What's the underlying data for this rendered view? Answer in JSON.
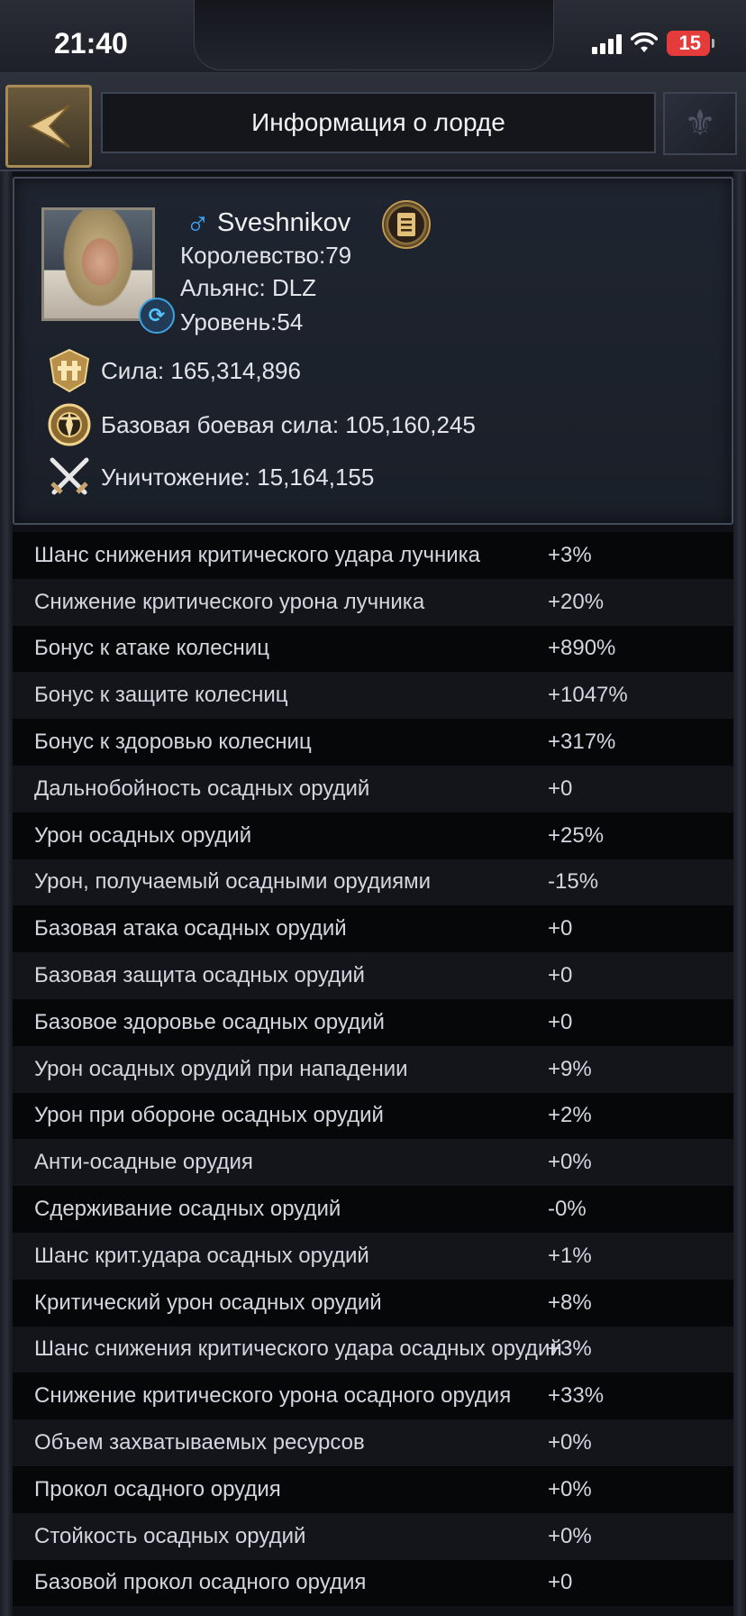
{
  "status_bar": {
    "time": "21:40",
    "battery": "15"
  },
  "header": {
    "title": "Информация о лорде"
  },
  "profile": {
    "name": "Sveshnikov",
    "kingdom": "Королевство:79",
    "alliance": "Альянс: DLZ",
    "level": "Уровень:54",
    "power": "Сила: 165,314,896",
    "base_power": "Базовая боевая сила: 105,160,245",
    "kills": "Уничтожение: 15,164,155"
  },
  "attributes": [
    {
      "label": "Шанс снижения критического удара лучника",
      "value": "+3%"
    },
    {
      "label": "Снижение критического урона лучника",
      "value": "+20%"
    },
    {
      "label": "Бонус к атаке колесниц",
      "value": "+890%"
    },
    {
      "label": "Бонус к защите колесниц",
      "value": "+1047%"
    },
    {
      "label": "Бонус к здоровью колесниц",
      "value": "+317%"
    },
    {
      "label": "Дальнобойность осадных орудий",
      "value": "+0"
    },
    {
      "label": "Урон осадных орудий",
      "value": "+25%"
    },
    {
      "label": "Урон, получаемый осадными орудиями",
      "value": "-15%"
    },
    {
      "label": "Базовая атака осадных орудий",
      "value": "+0"
    },
    {
      "label": "Базовая защита осадных орудий",
      "value": "+0"
    },
    {
      "label": "Базовое здоровье осадных орудий",
      "value": "+0"
    },
    {
      "label": "Урон осадных орудий при нападении",
      "value": "+9%"
    },
    {
      "label": "Урон при обороне осадных орудий",
      "value": "+2%"
    },
    {
      "label": "Анти-осадные орудия",
      "value": "+0%"
    },
    {
      "label": "Сдерживание осадных орудий",
      "value": "-0%"
    },
    {
      "label": "Шанс крит.удара осадных орудий",
      "value": "+1%"
    },
    {
      "label": "Критический урон осадных орудий",
      "value": "+8%"
    },
    {
      "label": "Шанс снижения критического удара осадных орудий",
      "value": "+3%"
    },
    {
      "label": "Снижение критического урона осадного орудия",
      "value": "+33%"
    },
    {
      "label": "Объем захватываемых ресурсов",
      "value": "+0%"
    },
    {
      "label": "Прокол осадного орудия",
      "value": "+0%"
    },
    {
      "label": "Стойкость осадных орудий",
      "value": "+0%"
    },
    {
      "label": "Базовой прокол осадного орудия",
      "value": "+0"
    }
  ]
}
